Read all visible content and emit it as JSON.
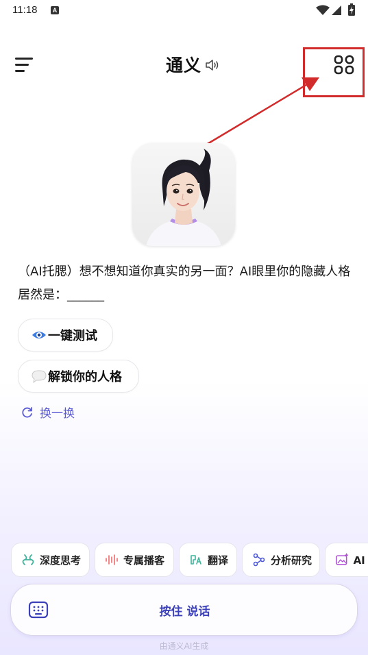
{
  "status_bar": {
    "time": "11:18",
    "notification_badge": "A",
    "icons": [
      "wifi-icon",
      "signal-icon",
      "battery-charging-icon"
    ]
  },
  "header": {
    "title": "通义",
    "menu_icon": "menu-icon",
    "speaker_icon": "speaker-icon",
    "grid_icon": "apps-grid-icon"
  },
  "annotation": {
    "box_color": "#d22b2b"
  },
  "message": {
    "text": "（AI托腮）想不想知道你真实的另一面？AI眼里你的隐藏人格居然是：______"
  },
  "suggestions": [
    {
      "label": "一键测试",
      "icon": "eye-icon"
    },
    {
      "label": "解锁你的人格",
      "icon": "speech-bubble-icon"
    }
  ],
  "refresh": {
    "label": "换一换"
  },
  "tools": [
    {
      "label": "深度思考",
      "icon": "deep-think-icon"
    },
    {
      "label": "专属播客",
      "icon": "podcast-waveform-icon"
    },
    {
      "label": "翻译",
      "icon": "translate-icon"
    },
    {
      "label": "分析研究",
      "icon": "analysis-icon"
    },
    {
      "label": "AI 生",
      "icon": "ai-image-icon"
    }
  ],
  "voice_bar": {
    "label": "按住 说话",
    "keyboard_icon": "keyboard-icon"
  },
  "footer": {
    "text": "由通义AI生成"
  },
  "colors": {
    "accent": "#5b5bd6",
    "voice_label": "#3b3fb8",
    "annotation_red": "#d22b2b"
  }
}
